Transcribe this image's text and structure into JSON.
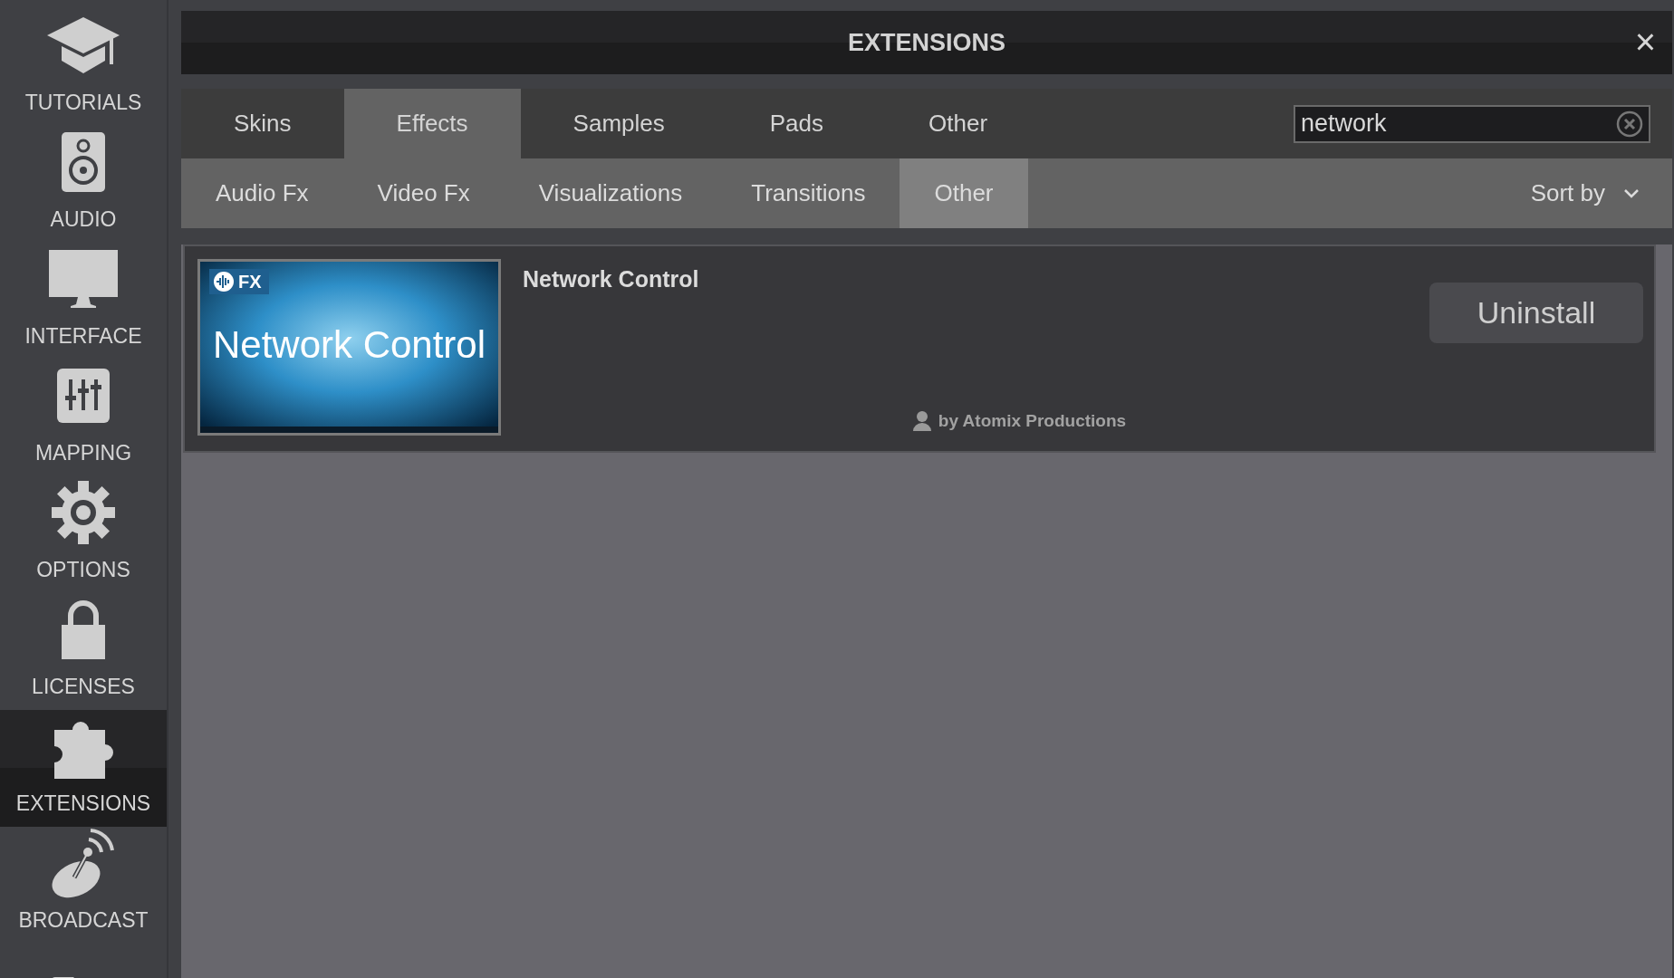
{
  "sidebar": {
    "items": [
      {
        "label": "TUTORIALS",
        "selected": false
      },
      {
        "label": "AUDIO",
        "selected": false
      },
      {
        "label": "INTERFACE",
        "selected": false
      },
      {
        "label": "MAPPING",
        "selected": false
      },
      {
        "label": "OPTIONS",
        "selected": false
      },
      {
        "label": "LICENSES",
        "selected": false
      },
      {
        "label": "EXTENSIONS",
        "selected": true
      },
      {
        "label": "BROADCAST",
        "selected": false
      }
    ]
  },
  "window": {
    "title": "EXTENSIONS",
    "close": "×"
  },
  "tabs": [
    {
      "label": "Skins",
      "selected": false
    },
    {
      "label": "Effects",
      "selected": true
    },
    {
      "label": "Samples",
      "selected": false
    },
    {
      "label": "Pads",
      "selected": false
    },
    {
      "label": "Other",
      "selected": false
    }
  ],
  "search": {
    "value": "network"
  },
  "subtabs": [
    {
      "label": "Audio Fx",
      "selected": false
    },
    {
      "label": "Video Fx",
      "selected": false
    },
    {
      "label": "Visualizations",
      "selected": false
    },
    {
      "label": "Transitions",
      "selected": false
    },
    {
      "label": "Other",
      "selected": true
    }
  ],
  "sort": {
    "label": "Sort by"
  },
  "results": [
    {
      "title": "Network Control",
      "thumbnail": {
        "badge": "FX",
        "caption": "Network Control"
      },
      "author": "by Atomix Productions",
      "action": "Uninstall"
    }
  ]
}
